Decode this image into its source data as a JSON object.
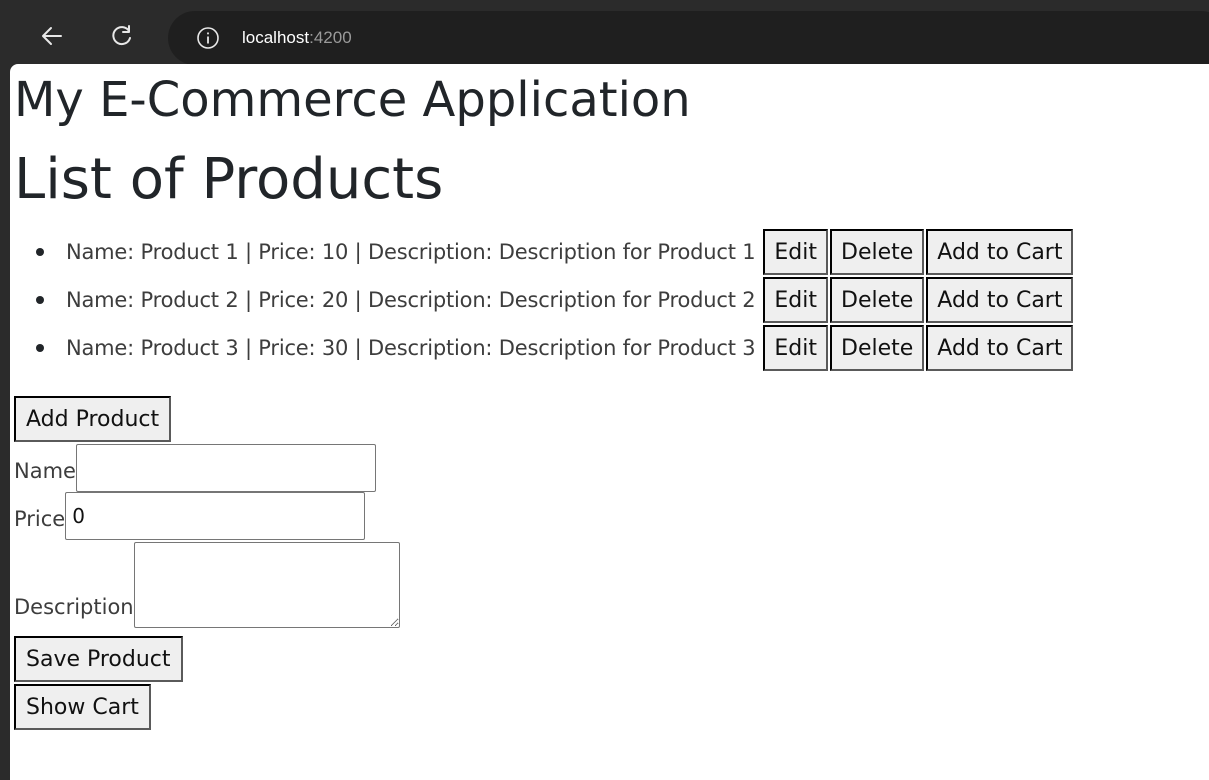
{
  "browser": {
    "url_host": "localhost",
    "url_port": ":4200",
    "icons": [
      "back-arrow-icon",
      "reload-icon",
      "info-icon"
    ]
  },
  "page": {
    "app_title": "My E-Commerce Application",
    "list_title": "List of Products",
    "products": [
      {
        "text": "Name: Product 1 | Price: 10 | Description: Description for Product 1",
        "edit_label": "Edit",
        "delete_label": "Delete",
        "add_to_cart_label": "Add to Cart"
      },
      {
        "text": "Name: Product 2 | Price: 20 | Description: Description for Product 2",
        "edit_label": "Edit",
        "delete_label": "Delete",
        "add_to_cart_label": "Add to Cart"
      },
      {
        "text": "Name: Product 3 | Price: 30 | Description: Description for Product 3",
        "edit_label": "Edit",
        "delete_label": "Delete",
        "add_to_cart_label": "Add to Cart"
      }
    ],
    "add_product_label": "Add Product",
    "form": {
      "name_label": "Name",
      "name_value": "",
      "price_label": "Price",
      "price_value": "0",
      "description_label": "Description",
      "description_value": ""
    },
    "save_product_label": "Save Product",
    "show_cart_label": "Show Cart"
  }
}
